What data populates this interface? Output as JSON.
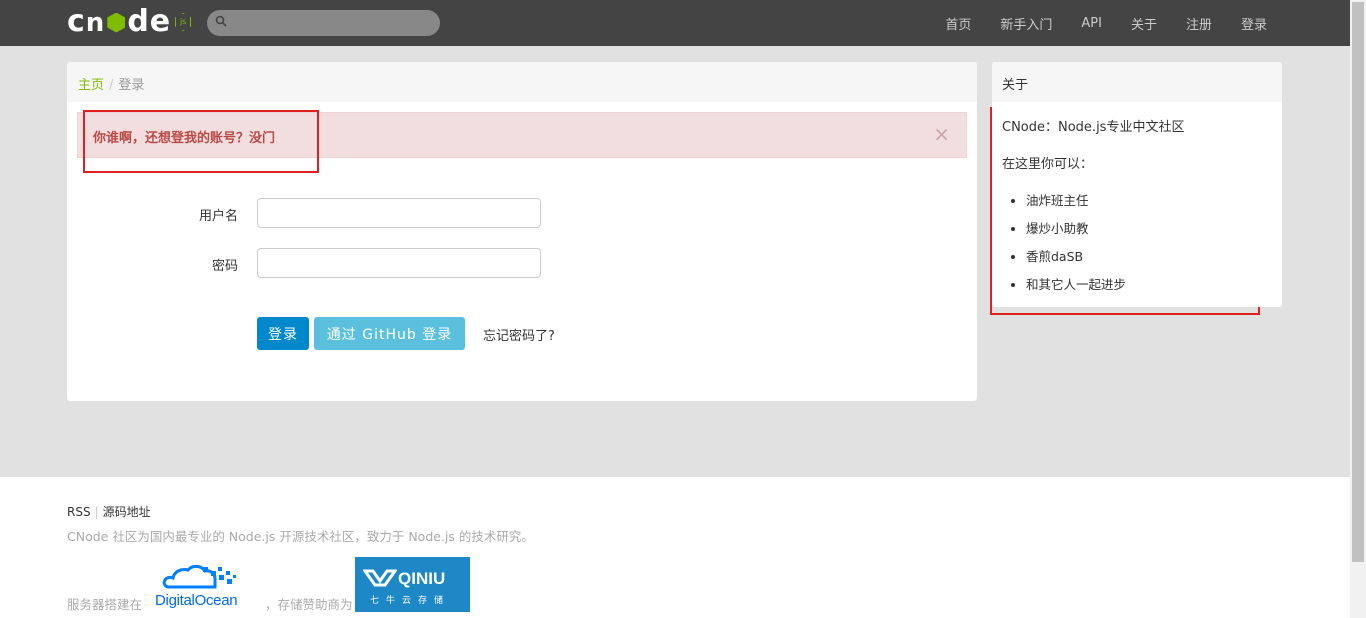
{
  "navbar": {
    "logo_text": "cnode",
    "logo_badge": "js",
    "search_placeholder": "",
    "links": [
      "首页",
      "新手入门",
      "API",
      "关于",
      "注册",
      "登录"
    ]
  },
  "breadcrumb": {
    "home": "主页",
    "separator": "/",
    "current": "登录"
  },
  "alert": {
    "message": "你谁啊，还想登我的账号？没门",
    "close": "×"
  },
  "form": {
    "username_label": "用户名",
    "username_value": "",
    "password_label": "密码",
    "password_value": "",
    "login_button": "登录",
    "github_button": "通过 GitHub 登录",
    "forgot_link": "忘记密码了?"
  },
  "sidebar": {
    "title": "关于",
    "intro": "CNode：Node.js专业中文社区",
    "subtitle": "在这里你可以：",
    "items": [
      "油炸班主任",
      "爆炒小助教",
      "香煎daSB",
      "和其它人一起进步"
    ]
  },
  "footer": {
    "rss": "RSS",
    "source": "源码地址",
    "description": "CNode 社区为国内最专业的 Node.js 开源技术社区，致力于 Node.js 的技术研究。",
    "hosted_on": "服务器搭建在",
    "digitalocean": "DigitalOcean",
    "sponsor": "，存储赞助商为",
    "qiniu_name": "QINIU",
    "qiniu_sub": "七牛云存储"
  },
  "colors": {
    "navbar_bg": "#444444",
    "accent_green": "#80bd01",
    "primary_blue": "#0088cc",
    "info_blue": "#5bc0de",
    "alert_bg": "#f2dede",
    "alert_text": "#b94a48",
    "highlight_red": "#e02020"
  }
}
